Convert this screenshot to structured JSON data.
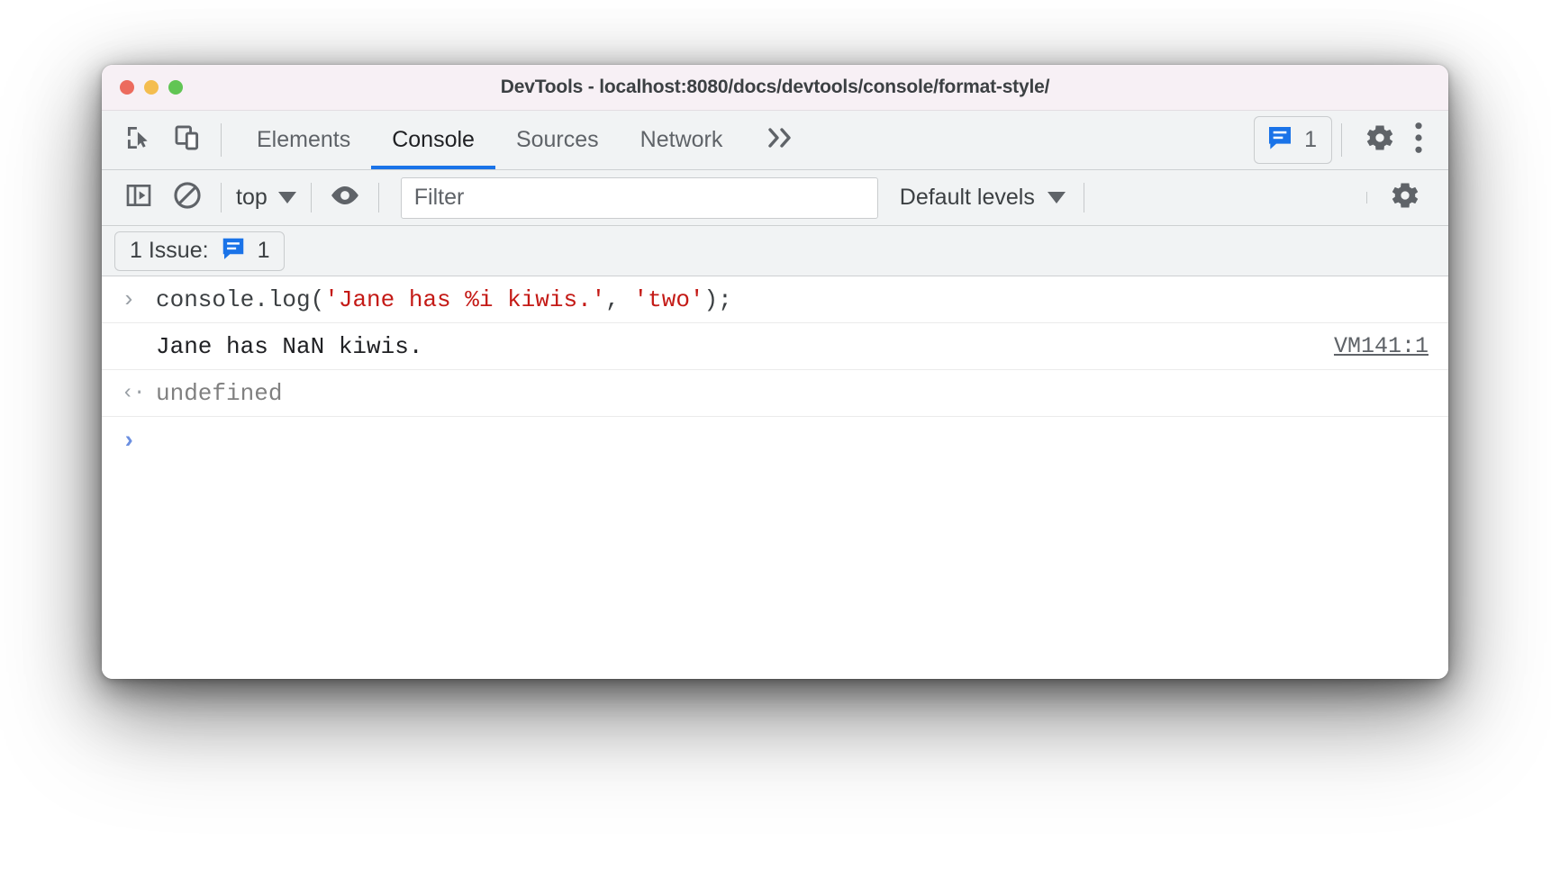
{
  "window": {
    "title": "DevTools - localhost:8080/docs/devtools/console/format-style/",
    "traffic_lights": {
      "close": "close-button",
      "minimize": "minimize-button",
      "maximize": "maximize-button"
    }
  },
  "tabbar": {
    "inspect_icon": "inspect-element-icon",
    "device_icon": "device-toolbar-icon",
    "tabs": [
      {
        "label": "Elements",
        "active": false
      },
      {
        "label": "Console",
        "active": true
      },
      {
        "label": "Sources",
        "active": false
      },
      {
        "label": "Network",
        "active": false
      }
    ],
    "more_tabs_icon": "chevron-double-right-icon",
    "issues_badge": {
      "icon": "issues-message-icon",
      "count": "1"
    },
    "settings_icon": "gear-icon",
    "menu_icon": "kebab-menu-icon"
  },
  "filterbar": {
    "sidebar_icon": "console-sidebar-icon",
    "clear_icon": "clear-console-icon",
    "context": "top",
    "context_caret": "chevron-down-icon",
    "eye_icon": "live-expression-icon",
    "filter_placeholder": "Filter",
    "filter_value": "",
    "levels_label": "Default levels",
    "levels_caret": "chevron-down-icon",
    "settings_icon": "gear-icon"
  },
  "issues_bar": {
    "label": "1 Issue:",
    "icon": "issues-message-icon",
    "count": "1"
  },
  "console": {
    "entries": [
      {
        "type": "input",
        "gutter": "›",
        "tokens": [
          {
            "text": "console.log(",
            "kind": "code"
          },
          {
            "text": "'Jane has %i kiwis.'",
            "kind": "string"
          },
          {
            "text": ", ",
            "kind": "code"
          },
          {
            "text": "'two'",
            "kind": "string"
          },
          {
            "text": ");",
            "kind": "code"
          }
        ],
        "source": ""
      },
      {
        "type": "output",
        "gutter": "",
        "text": "Jane has NaN kiwis.",
        "source": "VM141:1"
      },
      {
        "type": "result",
        "gutter": "‹·",
        "text": "undefined",
        "source": ""
      },
      {
        "type": "prompt",
        "gutter": "›",
        "text": "",
        "source": ""
      }
    ]
  }
}
